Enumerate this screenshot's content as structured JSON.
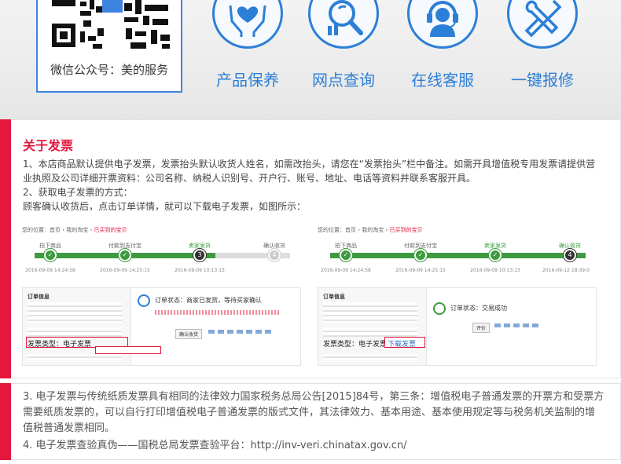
{
  "qr": {
    "caption": "微信公众号：美的服务"
  },
  "services": [
    {
      "label": "产品保养",
      "icon": "hands-heart-icon"
    },
    {
      "label": "网点查询",
      "icon": "magnifier-chart-icon"
    },
    {
      "label": "在线客服",
      "icon": "headset-agent-icon"
    },
    {
      "label": "一键报修",
      "icon": "tools-icon"
    }
  ],
  "invoice": {
    "title": "关于发票",
    "p1": "1、本店商品默认提供电子发票，发票抬头默认收货人姓名，如需改抬头，请您在“发票抬头”栏中备注。如需开具增值税专用发票请提供营业执照及公司详细开票资料：公司名称、纳税人识别号、开户行、账号、地址、电话等资料并联系客服开具。",
    "p2": "2、获取电子发票的方式：",
    "p3": "顾客确认收货后，点击订单详情，就可以下载电子发票，如图所示："
  },
  "shots": [
    {
      "crumb": "您的位置：首页 › 我的淘宝 › ",
      "crumb_hl": "已买到的宝贝",
      "steps": [
        "拍下商品",
        "付款到支付宝",
        "卖家发货",
        "确认收货"
      ],
      "times": [
        "2016-09-09 14:24:58",
        "2016-09-09 14:25:15",
        "2016-09-09 10:13:13",
        ""
      ],
      "info_title": "订单信息",
      "status": "订单状态：商家已发货，等待买家确认",
      "invoice_type": "发票类型：电子发票",
      "btn": "确认收货"
    },
    {
      "crumb": "您的位置：首页 › 我的淘宝 › ",
      "crumb_hl": "已买到的宝贝",
      "steps": [
        "拍下商品",
        "付款到支付宝",
        "卖家发货",
        "确认收货"
      ],
      "times": [
        "2016-09-09 14:24:58",
        "2016-09-09 14:25:15",
        "2016-09-09 10:13:13",
        "2016-09-12 18:39:0"
      ],
      "info_title": "订单信息",
      "status": "订单状态：交易成功",
      "invoice_type": "发票类型：电子发票",
      "download": "下载发票",
      "btn": "评价"
    }
  ],
  "notes": {
    "n3": "3. 电子发票与传统纸质发票具有相同的法律效力国家税务总局公告[2015]84号，第三条：增值税电子普通发票的开票方和受票方需要纸质发票的，可以自行打印增值税电子普通发票的版式文件，其法律效力、基本用途、基本使用规定等与税务机关监制的增值税普通发票相同。",
    "n4": "4. 电子发票查验真伪——国税总局发票查验平台：http://inv-veri.chinatax.gov.cn/"
  },
  "colors": {
    "accent": "#e4173c",
    "brand_blue": "#2c7fd6",
    "success": "#3e9a3e"
  }
}
